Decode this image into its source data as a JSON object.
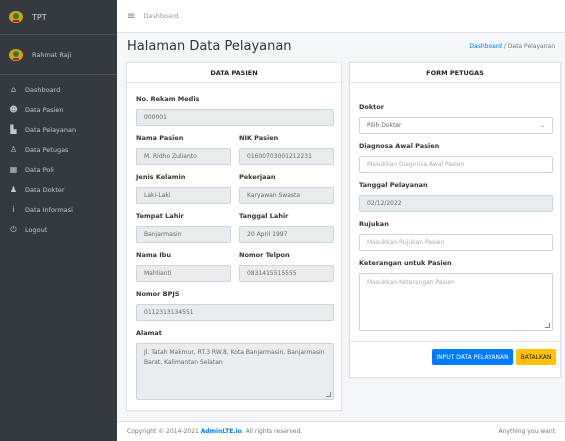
{
  "sidebar": {
    "brand": "TPT",
    "user": "Rahmat Raji",
    "items": [
      {
        "label": "Dashboard",
        "icon": "home-icon"
      },
      {
        "label": "Data Pasien",
        "icon": "users-icon"
      },
      {
        "label": "Data Pelayanan",
        "icon": "chart-icon"
      },
      {
        "label": "Data Petugas",
        "icon": "user-icon"
      },
      {
        "label": "Data Poli",
        "icon": "hospital-icon"
      },
      {
        "label": "Data Dokter",
        "icon": "doctor-icon"
      },
      {
        "label": "Data Informasi",
        "icon": "info-icon"
      },
      {
        "label": "Logout",
        "icon": "power-icon"
      }
    ]
  },
  "topbar": {
    "breadcrumb": "Dashboard"
  },
  "header": {
    "title": "Halaman Data Pelayanan",
    "crumb_home": "Dashboard",
    "crumb_sep": " / ",
    "crumb_current": "Data Pelayanan"
  },
  "patient": {
    "title": "DATA PASIEN",
    "rm_label": "No. Rekam Medis",
    "rm_value": "000001",
    "name_label": "Nama Pasien",
    "name_value": "M. Ridho Zulianto",
    "nik_label": "NIK Pasien",
    "nik_value": "01600703001212231",
    "gender_label": "Jenis Kelamin",
    "gender_value": "Laki-Laki",
    "job_label": "Pekerjaan",
    "job_value": "Karyawan Swasta",
    "birthplace_label": "Tempat Lahir",
    "birthplace_value": "Banjarmasin",
    "birthdate_label": "Tanggal Lahir",
    "birthdate_value": "20 April 1997",
    "mother_label": "Nama Ibu",
    "mother_value": "Mahlianti",
    "phone_label": "Nomor Telpon",
    "phone_value": "0831415515555",
    "bpjs_label": "Nomor BPJS",
    "bpjs_value": "0112313134551",
    "address_label": "Alamat",
    "address_value": "Jl. Tatah Makmur, RT.3 RW.8, Kota Banjarmasin, Banjarmasin Barat, Kalimantan Selatan"
  },
  "officer": {
    "title": "FORM PETUGAS",
    "doctor_label": "Doktor",
    "doctor_selected": "Pilih Dokter",
    "diag_label": "Diagnosa Awal Pasien",
    "diag_placeholder": "Masukkan Diagnosa Awal Pasien",
    "date_label": "Tanggal Pelayanan",
    "date_value": "02/12/2022",
    "ref_label": "Rujukan",
    "ref_placeholder": "Masukkan Rujukan Pasien",
    "note_label": "Keterangan untuk Pasien",
    "note_placeholder": "Masukkan Keterangan Pasien",
    "submit_label": "INPUT DATA PELAYANAN",
    "cancel_label": "BATALKAN"
  },
  "footer": {
    "prefix": "Copyright © 2014-2021 ",
    "link": "AdminLTE.io",
    "suffix": ". All rights reserved.",
    "right": "Anything you want"
  }
}
